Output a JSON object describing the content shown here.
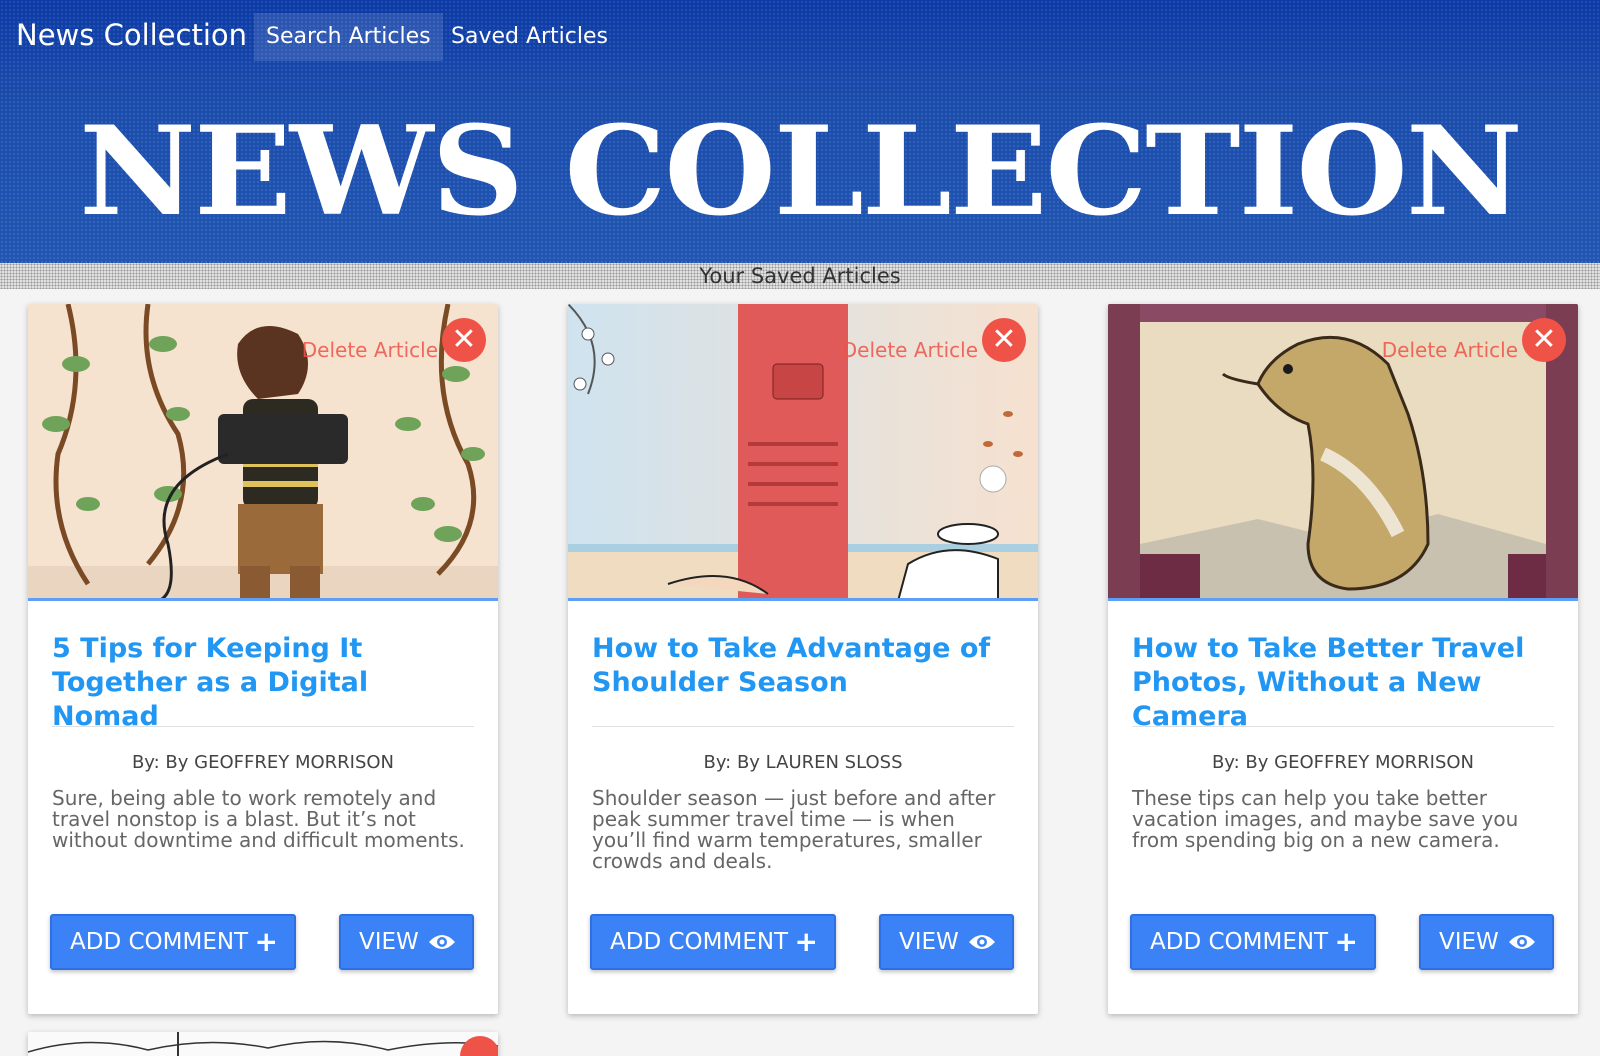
{
  "nav": {
    "brand": "News Collection",
    "links": [
      {
        "label": "Search Articles",
        "active": true
      },
      {
        "label": "Saved Articles",
        "active": false
      }
    ]
  },
  "hero": {
    "title": "NEWS COLLECTION"
  },
  "subheader": {
    "label": "Your Saved Articles"
  },
  "colors": {
    "accent": "#3b82f6",
    "title_link": "#2196f3",
    "delete": "#ef5247",
    "hero": "#1d4fb0"
  },
  "articles": [
    {
      "delete_label": "Delete Article",
      "title": "5 Tips for Keeping It Together as a Digital Nomad",
      "byline": "By: By GEOFFREY MORRISON",
      "summary": "Sure, being able to work remotely and travel nonstop is a blast. But it’s not without downtime and difficult moments.",
      "comment_label": "ADD COMMENT",
      "view_label": "VIEW"
    },
    {
      "delete_label": "Delete Article",
      "title": "How to Take Advantage of Shoulder Season",
      "byline": "By: By LAUREN SLOSS",
      "summary": "Shoulder season — just before and after peak summer travel time — is when you’ll find warm temperatures, smaller crowds and deals.",
      "comment_label": "ADD COMMENT",
      "view_label": "VIEW"
    },
    {
      "delete_label": "Delete Article",
      "title": "How to Take Better Travel Photos, Without a New Camera",
      "byline": "By: By GEOFFREY MORRISON",
      "summary": "These tips can help you take better vacation images, and maybe save you from spending big on a new camera.",
      "comment_label": "ADD COMMENT",
      "view_label": "VIEW"
    }
  ],
  "icons": {
    "delete": "close-circle-icon",
    "add": "plus-icon",
    "view": "eye-icon"
  }
}
